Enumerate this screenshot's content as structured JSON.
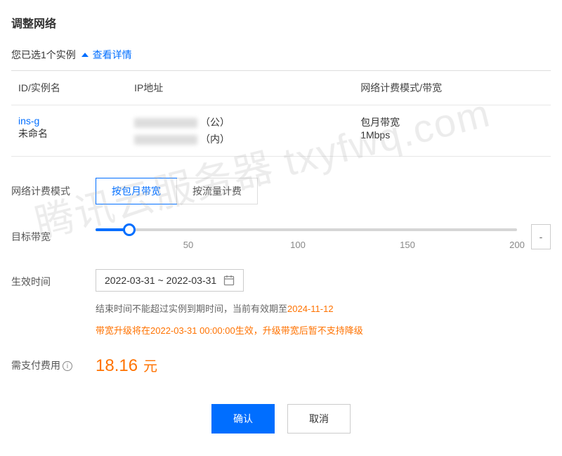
{
  "page_title": "调整网络",
  "selection": {
    "text": "您已选1个实例",
    "view_details": "查看详情"
  },
  "table": {
    "headers": {
      "id_name": "ID/实例名",
      "ip": "IP地址",
      "billing": "网络计费模式/带宽"
    },
    "row": {
      "instance_id": "ins-g",
      "instance_name": "未命名",
      "ip_public_suffix": "（公）",
      "ip_private_suffix": "（内）",
      "billing_mode": "包月带宽",
      "bandwidth": "1Mbps"
    }
  },
  "form": {
    "billing_mode_label": "网络计费模式",
    "billing_options": {
      "monthly": "按包月带宽",
      "traffic": "按流量计费"
    },
    "target_bw_label": "目标带宽",
    "slider_ticks": [
      "50",
      "100",
      "150",
      "200"
    ],
    "spinner_minus": "-",
    "effective_time_label": "生效时间",
    "date_range": "2022-03-31 ~ 2022-03-31",
    "hint_prefix": "结束时间不能超过实例到期时间，当前有效期至",
    "hint_date": "2024-11-12",
    "warning": "带宽升级将在2022-03-31 00:00:00生效，升级带宽后暂不支持降级",
    "cost_label": "需支付费用",
    "price": "18.16",
    "price_unit": "元"
  },
  "buttons": {
    "confirm": "确认",
    "cancel": "取消"
  },
  "watermark": "腾讯云服务器 txyfwq.com"
}
